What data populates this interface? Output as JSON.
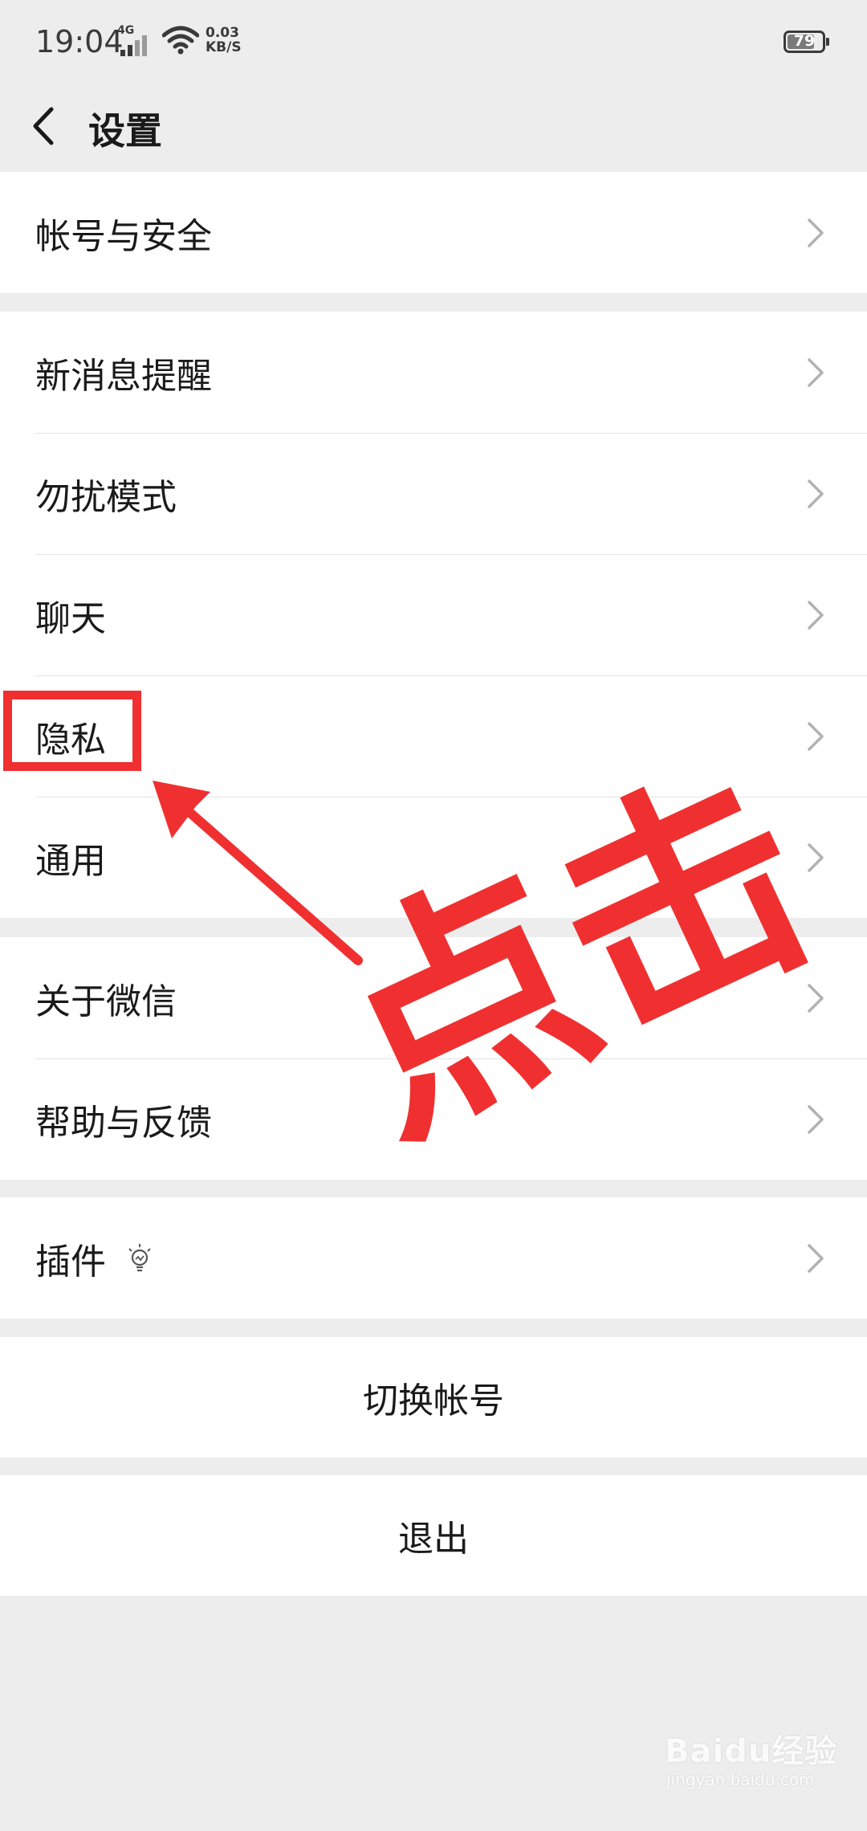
{
  "status_bar": {
    "time": "19:04",
    "network": "4G",
    "speed_value": "0.03",
    "speed_unit": "KB/S",
    "battery_level": "79",
    "battery_fraction": 0.79
  },
  "nav": {
    "title": "设置"
  },
  "groups": {
    "account": [
      "帐号与安全"
    ],
    "main": [
      "新消息提醒",
      "勿扰模式",
      "聊天",
      "隐私",
      "通用"
    ],
    "about": [
      "关于微信",
      "帮助与反馈"
    ],
    "plugins": [
      "插件"
    ]
  },
  "actions": {
    "switch_account": "切换帐号",
    "logout": "退出"
  },
  "annotation": {
    "callout_text": "点击",
    "color": "#f03030"
  },
  "watermark": {
    "brand": "Baidu经验",
    "url": "jingyan.baidu.com"
  }
}
